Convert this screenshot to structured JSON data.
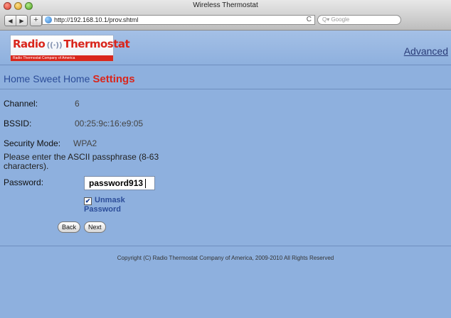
{
  "window": {
    "title": "Wireless Thermostat"
  },
  "toolbar": {
    "back_icon": "◀",
    "forward_icon": "▶",
    "add_icon": "+",
    "url": "http://192.168.10.1/prov.shtml",
    "reload_icon": "C",
    "search_placeholder": "Q▾ Google"
  },
  "header": {
    "logo_text_left": "Radio",
    "logo_text_right": "Thermostat",
    "logo_tagline": "Radio Thermostat Company of America",
    "advanced_link": "Advanced"
  },
  "breadcrumb": {
    "home": "Home Sweet Home",
    "current": "Settings"
  },
  "fields": {
    "channel_label": "Channel:",
    "channel_value": "6",
    "bssid_label": "BSSID:",
    "bssid_value": "00:25:9c:16:e9:05",
    "security_label": "Security Mode:",
    "security_value": "WPA2",
    "note": "Please enter the ASCII passphrase (8-63 characters).",
    "password_label": "Password:",
    "password_value": "password913",
    "unmask_checked": true,
    "unmask_label_1": "Unmask",
    "unmask_label_2": "Password"
  },
  "buttons": {
    "back": "Back",
    "next": "Next"
  },
  "footer": {
    "copyright": "Copyright (C) Radio Thermostat Company of America, 2009-2010 All Rights Reserved"
  },
  "colors": {
    "page_background": "#8eb0de",
    "brand_red": "#d9261c",
    "link_blue": "#2c4d99"
  }
}
